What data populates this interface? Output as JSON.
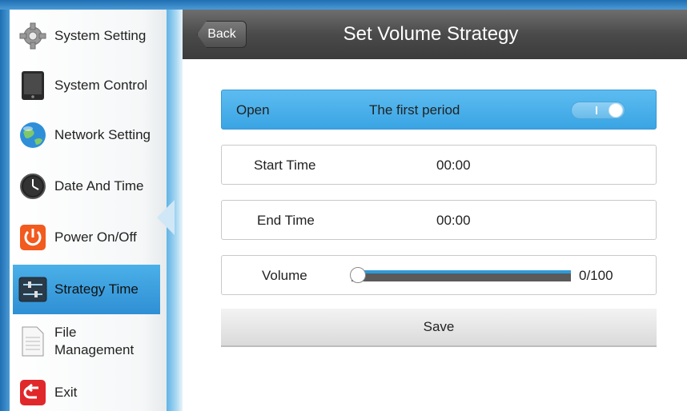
{
  "sidebar": {
    "items": [
      {
        "label": "System Setting",
        "icon": "gear-icon"
      },
      {
        "label": "System Control",
        "icon": "tablet-icon"
      },
      {
        "label": "Network Setting",
        "icon": "globe-icon"
      },
      {
        "label": "Date And Time",
        "icon": "clock-icon"
      },
      {
        "label": "Power On/Off",
        "icon": "power-icon"
      },
      {
        "label": "Strategy Time",
        "icon": "sliders-icon",
        "active": true
      },
      {
        "label": "File\nManagement",
        "icon": "document-icon"
      },
      {
        "label": "Exit",
        "icon": "exit-icon"
      }
    ]
  },
  "header": {
    "back_label": "Back",
    "title": "Set Volume Strategy"
  },
  "form": {
    "open_label": "Open",
    "period_label": "The first period",
    "start_label": "Start Time",
    "start_value": "00:00",
    "end_label": "End Time",
    "end_value": "00:00",
    "volume_label": "Volume",
    "volume_value": 0,
    "volume_max": 100,
    "volume_text": "0/100",
    "save_label": "Save"
  },
  "colors": {
    "accent": "#3aa4e4",
    "header": "#4a4a4a"
  }
}
